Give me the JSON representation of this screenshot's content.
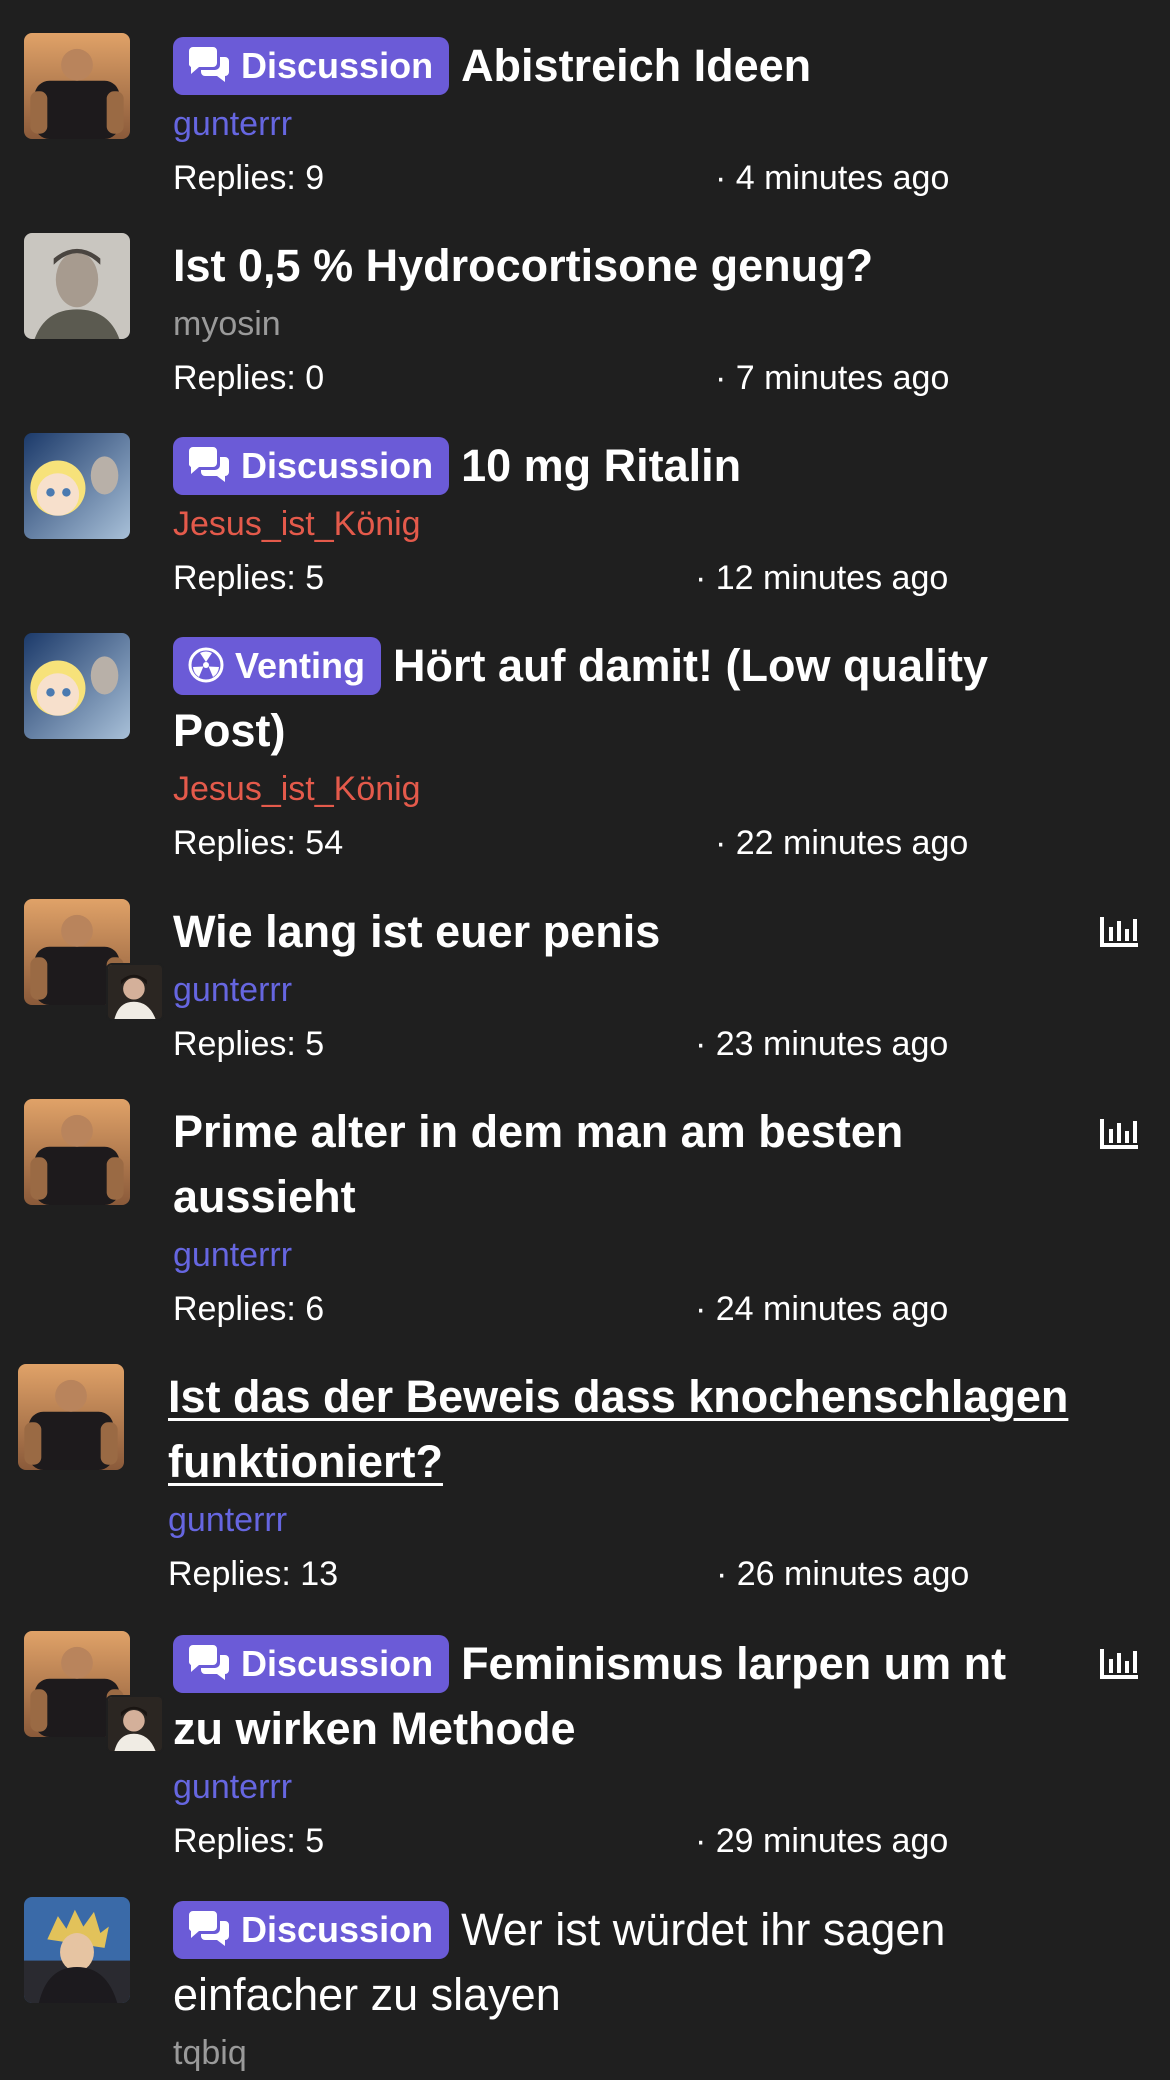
{
  "threads": [
    {
      "prefix": "Discussion",
      "prefix_icon": "chat-bubbles-icon",
      "title": "Abistreich Ideen",
      "author": "gunterrr",
      "replies": "Replies: 9",
      "time": "· 4 minutes ago",
      "poll": false
    },
    {
      "prefix": "",
      "title": "Ist 0,5 % Hydrocortisone genug?",
      "author": "myosin",
      "replies": "Replies: 0",
      "time": "· 7 minutes ago",
      "poll": false
    },
    {
      "prefix": "Discussion",
      "prefix_icon": "chat-bubbles-icon",
      "title": "10 mg Ritalin",
      "author": "Jesus_ist_König",
      "replies": "Replies: 5",
      "time": "· 12 minutes ago",
      "poll": false
    },
    {
      "prefix": "Venting",
      "prefix_icon": "radiation-icon",
      "title": "Hört auf damit! (Low quality Post)",
      "author": "Jesus_ist_König",
      "replies": "Replies: 54",
      "time": "· 22 minutes ago",
      "poll": false
    },
    {
      "prefix": "",
      "title": "Wie lang ist euer penis",
      "author": "gunterrr",
      "replies": "Replies: 5",
      "time": "· 23 minutes ago",
      "poll": true
    },
    {
      "prefix": "",
      "title": "Prime alter in dem man am besten aussieht",
      "author": "gunterrr",
      "replies": "Replies: 6",
      "time": "· 24 minutes ago",
      "poll": true
    },
    {
      "prefix": "",
      "title": "Ist das der Beweis dass knochenschlagen funktioniert?",
      "author": "gunterrr",
      "replies": "Replies: 13",
      "time": "· 26 minutes ago",
      "poll": false
    },
    {
      "prefix": "Discussion",
      "prefix_icon": "chat-bubbles-icon",
      "title": "Feminismus larpen um nt zu wirken Methode",
      "author": "gunterrr",
      "replies": "Replies: 5",
      "time": "· 29 minutes ago",
      "poll": true
    },
    {
      "prefix": "Discussion",
      "prefix_icon": "chat-bubbles-icon",
      "title": "Wer ist würdet ihr sagen einfacher zu slayen",
      "author": "tqbiq",
      "replies": "",
      "time": "",
      "poll": false
    }
  ],
  "colors": {
    "background": "#1f1f1f",
    "prefix_badge": "#6b5bd7",
    "author_purple": "#6666e0",
    "author_red": "#e45a4b",
    "author_gray": "#9a9a9a"
  }
}
